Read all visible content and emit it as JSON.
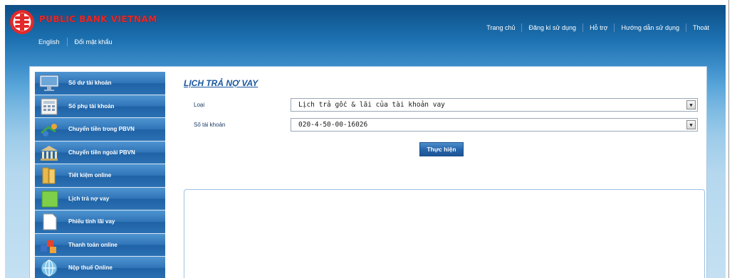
{
  "header": {
    "brand": "PUBLIC BANK VIETNAM",
    "subnav": [
      "English",
      "Đổi mật khẩu"
    ],
    "topnav": [
      "Trang chủ",
      "Đăng kí sử dụng",
      "Hỗ trợ",
      "Hướng dẫn sử dụng",
      "Thoát"
    ]
  },
  "sidebar": {
    "items": [
      {
        "label": "Số dư tài khoản",
        "icon": "monitor-icon"
      },
      {
        "label": "Số phụ tài khoản",
        "icon": "calculator-icon"
      },
      {
        "label": "Chuyển tiền trong PBVN",
        "icon": "transfer-icon"
      },
      {
        "label": "Chuyển tiền ngoài PBVN",
        "icon": "bank-icon"
      },
      {
        "label": "Tiết kiệm online",
        "icon": "savings-icon"
      },
      {
        "label": "Lịch trả nợ vay",
        "icon": "schedule-icon"
      },
      {
        "label": "Phiếu tính lãi vay",
        "icon": "document-icon"
      },
      {
        "label": "Thanh toán online",
        "icon": "payment-icon"
      },
      {
        "label": "Nộp thuế Online",
        "icon": "globe-icon"
      }
    ]
  },
  "main": {
    "title": "LỊCH TRẢ NỢ VAY",
    "fields": [
      {
        "label": "Loại",
        "value": "Lịch trả gốc & lãi của tài khoản vay"
      },
      {
        "label": "Số tài khoản",
        "value": "020-4-50-00-16026"
      }
    ],
    "submit_label": "Thực hiện"
  },
  "colors": {
    "brand_red": "#e22a2a",
    "header_blue": "#0d4e86",
    "link_blue": "#1b57a0"
  }
}
